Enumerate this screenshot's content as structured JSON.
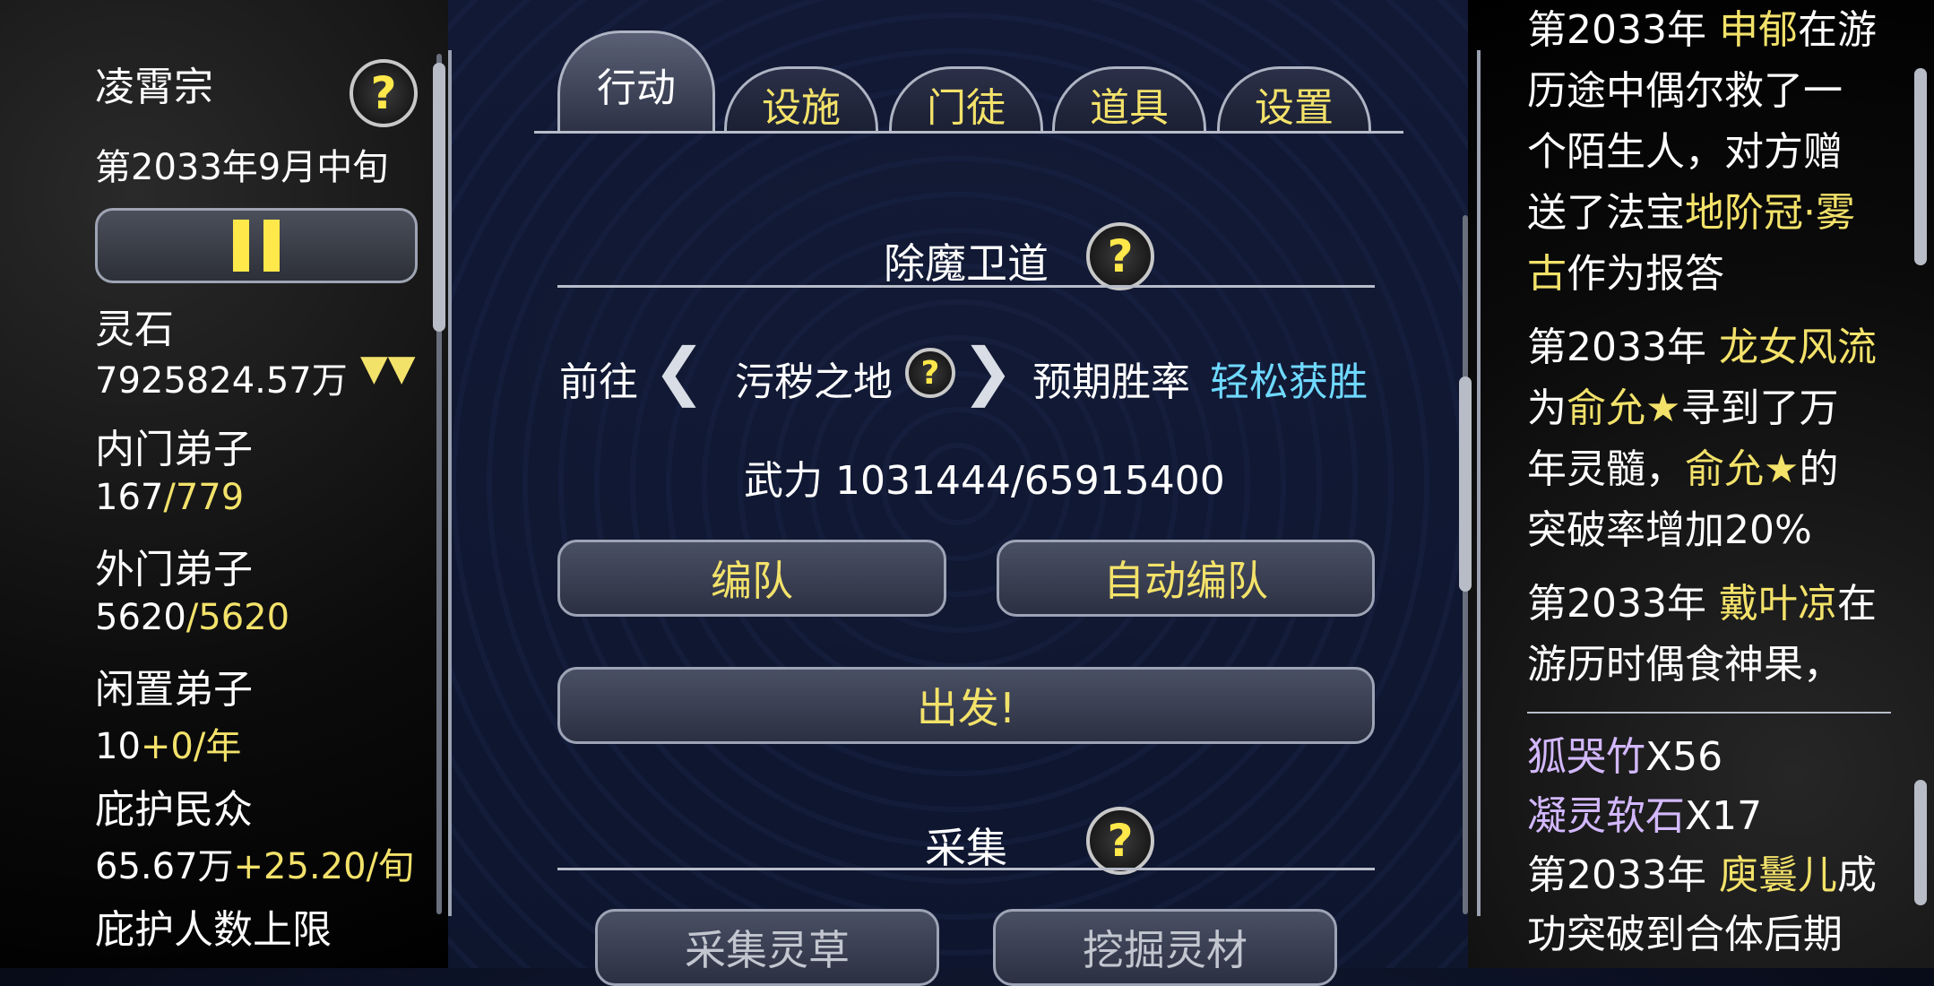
{
  "sidebar": {
    "sect_name": "凌霄宗",
    "date": "第2033年9月中旬",
    "pause_label": "II",
    "spirit_stone_label": "灵石",
    "spirit_stone_value": "7925824.57万",
    "spirit_stone_trend": "▼▼",
    "inner_label": "内门弟子",
    "inner_current": "167",
    "inner_max": "/779",
    "outer_label": "外门弟子",
    "outer_current": "5620",
    "outer_max": "/5620",
    "idle_label": "闲置弟子",
    "idle_current": "10",
    "idle_rate": "+0/年",
    "protect_label": "庇护民众",
    "protect_value": "65.67万",
    "protect_rate": "+25.20/旬",
    "protect_limit_label": "庇护人数上限"
  },
  "tabs": [
    {
      "label": "行动"
    },
    {
      "label": "设施"
    },
    {
      "label": "门徒"
    },
    {
      "label": "道具"
    },
    {
      "label": "设置"
    }
  ],
  "main": {
    "section1_title": "除魔卫道",
    "goto_label": "前往",
    "location": "污秽之地",
    "win_rate_label": "预期胜率",
    "win_rate_value": "轻松获胜",
    "force_label": "武力",
    "force_value": "1031444/65915400",
    "team_button": "编队",
    "auto_team_button": "自动编队",
    "depart_button": "出发!",
    "section2_title": "采集",
    "gather_herb_button": "采集灵草",
    "dig_material_button": "挖掘灵材"
  },
  "log": {
    "e1_year": "第2033年",
    "e1_name": "申郁",
    "e1_text1": "在游",
    "e1_text2": "历途中偶尔救了一",
    "e1_text3": "个陌生人，对方赠",
    "e1_text4": "送了法宝",
    "e1_item1": "地阶冠·雾",
    "e1_item2": "古",
    "e1_text5": "作为报答",
    "e2_year": "第2033年",
    "e2_name": "龙女风流",
    "e2_text1": "为",
    "e2_target": "俞允★",
    "e2_text2": "寻到了万",
    "e2_text3": "年灵髓，",
    "e2_target2": "俞允★",
    "e2_text4": "的",
    "e2_text5": "突破率增加20%",
    "e3_year": "第2033年",
    "e3_name": "戴叶凉",
    "e3_text1": "在",
    "e3_text2": "游历时偶食神果，",
    "loot1_name": "狐哭竹",
    "loot1_count": "X56",
    "loot2_name": "凝灵软石",
    "loot2_count": "X17",
    "e4_year": "第2033年",
    "e4_name": "庾鬟儿",
    "e4_text1": "成",
    "e4_text2": "功突破到合体后期"
  },
  "colors": {
    "highlight_yellow": "#f3e26a",
    "highlight_cyan": "#6fd9ff",
    "item_lavender": "#d3b8ff"
  }
}
